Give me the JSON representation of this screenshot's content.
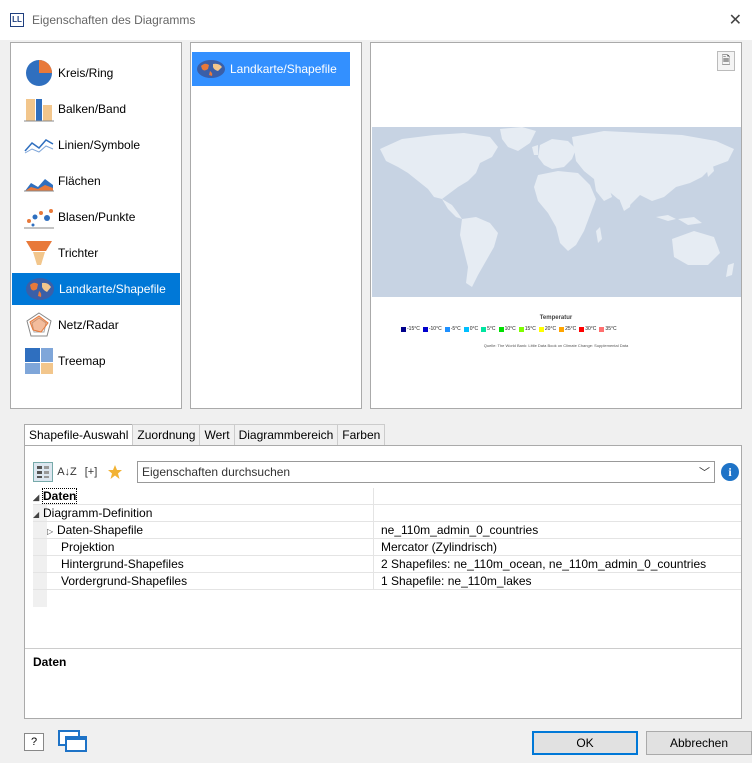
{
  "window": {
    "app_icon": "LL",
    "title": "Eigenschaften des Diagramms",
    "close": "✕"
  },
  "chart_types": [
    {
      "label": "Kreis/Ring",
      "icon": "pie-chart-icon"
    },
    {
      "label": "Balken/Band",
      "icon": "bar-chart-icon"
    },
    {
      "label": "Linien/Symbole",
      "icon": "line-chart-icon"
    },
    {
      "label": "Flächen",
      "icon": "area-chart-icon"
    },
    {
      "label": "Blasen/Punkte",
      "icon": "bubble-chart-icon"
    },
    {
      "label": "Trichter",
      "icon": "funnel-chart-icon"
    },
    {
      "label": "Landkarte/Shapefile",
      "icon": "map-icon",
      "selected": true
    },
    {
      "label": "Netz/Radar",
      "icon": "radar-chart-icon"
    },
    {
      "label": "Treemap",
      "icon": "treemap-icon"
    }
  ],
  "subtypes": [
    {
      "label": "Landkarte/Shapefile",
      "icon": "map-icon",
      "selected": true
    }
  ],
  "preview": {
    "legend_title": "Temperatur",
    "legend": [
      {
        "label": "-15°C",
        "color": "#00008b"
      },
      {
        "label": "-10°C",
        "color": "#0000cd"
      },
      {
        "label": "-5°C",
        "color": "#1e90ff"
      },
      {
        "label": "0°C",
        "color": "#00bfff"
      },
      {
        "label": "5°C",
        "color": "#00e5a0"
      },
      {
        "label": "10°C",
        "color": "#00e000"
      },
      {
        "label": "15°C",
        "color": "#7fff00"
      },
      {
        "label": "20°C",
        "color": "#ffff00"
      },
      {
        "label": "25°C",
        "color": "#ffa500"
      },
      {
        "label": "30°C",
        "color": "#ff0000"
      },
      {
        "label": "35°C",
        "color": "#ff6f6f"
      }
    ],
    "source": "Quelle: The World Bank: Little Data Book on Climate Change: Supplemental Data",
    "ocean_color": "#c7d3e3",
    "land_color": "#e6ecf3"
  },
  "tabs": [
    {
      "label": "Shapefile-Auswahl",
      "active": true
    },
    {
      "label": "Zuordnung"
    },
    {
      "label": "Wert"
    },
    {
      "label": "Diagrammbereich"
    },
    {
      "label": "Farben"
    }
  ],
  "toolbar": {
    "search_placeholder": "Eigenschaften durchsuchen",
    "sort_label": "A↓Z",
    "expand_label": "[+]"
  },
  "properties": {
    "section": "Daten",
    "group": "Diagramm-Definition",
    "rows": [
      {
        "name": "Daten-Shapefile",
        "value": "ne_110m_admin_0_countries",
        "expandable": true
      },
      {
        "name": "Projektion",
        "value": "Mercator (Zylindrisch)"
      },
      {
        "name": "Hintergrund-Shapefiles",
        "value": "2 Shapefiles: ne_110m_ocean, ne_110m_admin_0_countries"
      },
      {
        "name": "Vordergrund-Shapefiles",
        "value": "1 Shapefile: ne_110m_lakes"
      }
    ]
  },
  "description": {
    "title": "Daten"
  },
  "buttons": {
    "ok": "OK",
    "cancel": "Abbrechen",
    "help": "?"
  }
}
